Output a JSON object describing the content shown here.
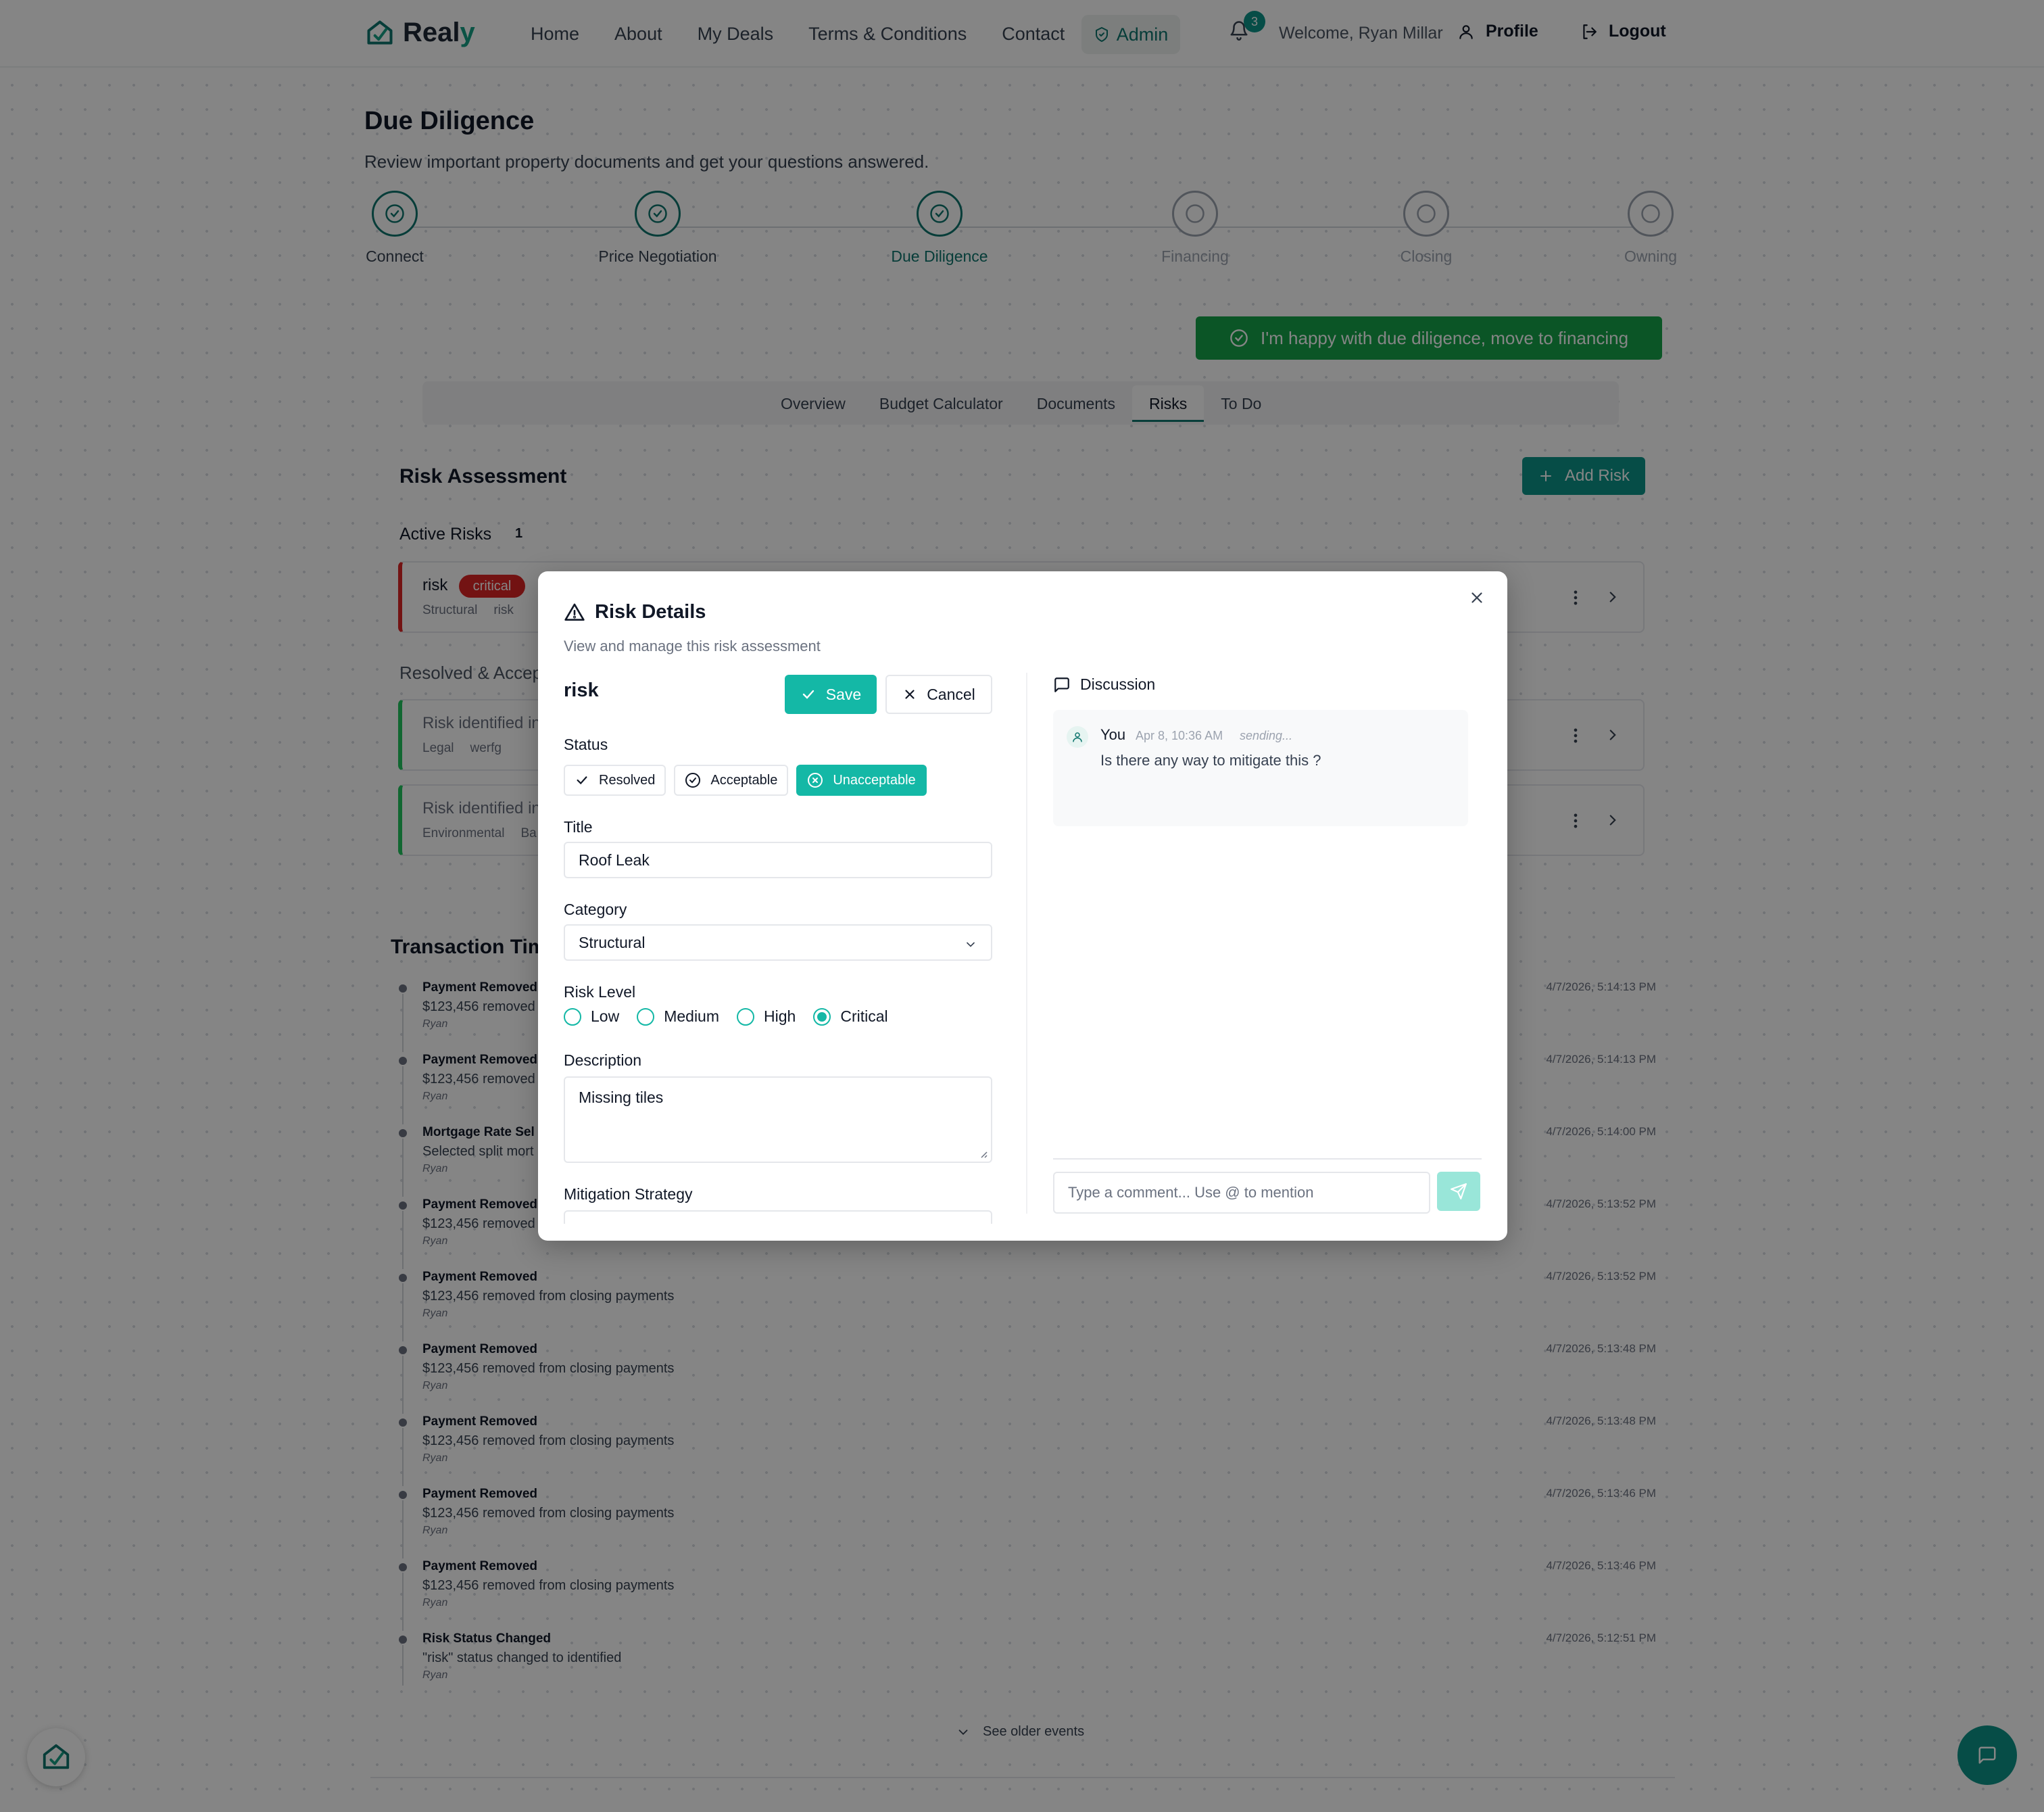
{
  "header": {
    "logo_main": "Real",
    "logo_accent": "y",
    "nav": [
      "Home",
      "About",
      "My Deals",
      "Terms & Conditions",
      "Contact"
    ],
    "admin_label": "Admin",
    "notification_count": "3",
    "welcome": "Welcome, Ryan Millar",
    "profile_label": "Profile",
    "logout_label": "Logout"
  },
  "page": {
    "title": "Due Diligence",
    "subtitle": "Review important property documents and get your questions answered."
  },
  "stepper": [
    {
      "label": "Connect",
      "state": "done"
    },
    {
      "label": "Price Negotiation",
      "state": "done"
    },
    {
      "label": "Due Diligence",
      "state": "current"
    },
    {
      "label": "Financing",
      "state": "pending"
    },
    {
      "label": "Closing",
      "state": "pending"
    },
    {
      "label": "Owning",
      "state": "pending"
    }
  ],
  "cta_label": "I'm happy with due diligence, move to financing",
  "tabs": [
    "Overview",
    "Budget Calculator",
    "Documents",
    "Risks",
    "To Do"
  ],
  "active_tab": "Risks",
  "risks": {
    "section_title": "Risk Assessment",
    "add_label": "Add Risk",
    "active_title": "Active Risks",
    "active_count": "1",
    "active_item": {
      "title": "risk",
      "level": "critical",
      "category": "Structural",
      "desc": "risk"
    },
    "resolved_title": "Resolved & Accep",
    "resolved_items": [
      {
        "title": "Risk identified in",
        "category": "Legal",
        "desc": "werfg"
      },
      {
        "title": "Risk identified in",
        "category": "Environmental",
        "desc": "Ba"
      }
    ]
  },
  "timeline": {
    "title": "Transaction Tim",
    "items": [
      {
        "title": "Payment Removed",
        "desc": "$123,456 removed",
        "user": "Ryan",
        "time": "4/7/2026, 5:14:13 PM"
      },
      {
        "title": "Payment Removed",
        "desc": "$123,456 removed",
        "user": "Ryan",
        "time": "4/7/2026, 5:14:13 PM"
      },
      {
        "title": "Mortgage Rate Sel",
        "desc": "Selected split mort",
        "user": "Ryan",
        "time": "4/7/2026, 5:14:00 PM"
      },
      {
        "title": "Payment Removed",
        "desc": "$123,456 removed",
        "user": "Ryan",
        "time": "4/7/2026, 5:13:52 PM"
      },
      {
        "title": "Payment Removed",
        "desc": "$123,456 removed from closing payments",
        "user": "Ryan",
        "time": "4/7/2026, 5:13:52 PM"
      },
      {
        "title": "Payment Removed",
        "desc": "$123,456 removed from closing payments",
        "user": "Ryan",
        "time": "4/7/2026, 5:13:48 PM"
      },
      {
        "title": "Payment Removed",
        "desc": "$123,456 removed from closing payments",
        "user": "Ryan",
        "time": "4/7/2026, 5:13:48 PM"
      },
      {
        "title": "Payment Removed",
        "desc": "$123,456 removed from closing payments",
        "user": "Ryan",
        "time": "4/7/2026, 5:13:46 PM"
      },
      {
        "title": "Payment Removed",
        "desc": "$123,456 removed from closing payments",
        "user": "Ryan",
        "time": "4/7/2026, 5:13:46 PM"
      },
      {
        "title": "Risk Status Changed",
        "desc": "\"risk\" status changed to identified",
        "user": "Ryan",
        "time": "4/7/2026, 5:12:51 PM"
      }
    ],
    "older_label": "See older events"
  },
  "modal": {
    "title": "Risk Details",
    "subtitle": "View and manage this risk assessment",
    "risk_name": "risk",
    "save_label": "Save",
    "cancel_label": "Cancel",
    "status_label": "Status",
    "status_options": [
      "Resolved",
      "Acceptable",
      "Unacceptable"
    ],
    "status_selected": "Unacceptable",
    "title_label": "Title",
    "title_value": "Roof Leak",
    "category_label": "Category",
    "category_value": "Structural",
    "level_label": "Risk Level",
    "levels": [
      "Low",
      "Medium",
      "High",
      "Critical"
    ],
    "level_selected": "Critical",
    "description_label": "Description",
    "description_value": "Missing tiles",
    "mitigation_label": "Mitigation Strategy",
    "discussion_label": "Discussion",
    "comment": {
      "author": "You",
      "time": "Apr 8, 10:36 AM",
      "state": "sending...",
      "text": "Is there any way to mitigate this ?"
    },
    "comment_placeholder": "Type a comment... Use @ to mention"
  },
  "colors": {
    "brand": "#0d9488",
    "success": "#16a34a",
    "danger": "#dc2626"
  }
}
